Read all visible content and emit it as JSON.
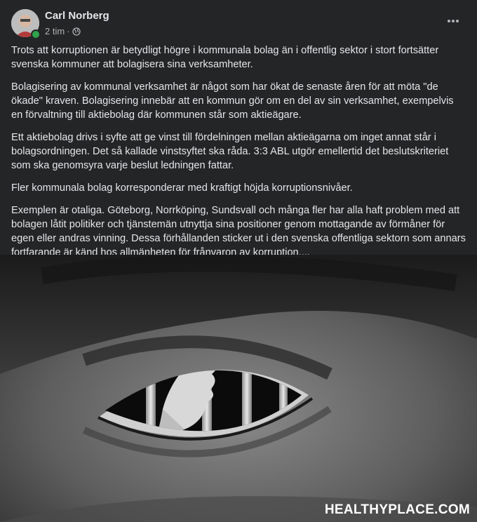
{
  "post": {
    "author": "Carl Norberg",
    "time": "2 tim",
    "separator": "·",
    "privacy_icon": "globe-icon",
    "more_icon": "more-options-icon",
    "paragraphs": [
      "Trots att korruptionen är betydligt högre i kommunala bolag än i offentlig sektor i stort fortsätter svenska kommuner att bolagisera sina verksamheter.",
      "Bolagisering av kommunal verksamhet är något som har ökat de senaste åren för att möta \"de ökade\" kraven. Bolagisering innebär att en kommun gör om en del av sin verksamhet, exempelvis en förvaltning till aktiebolag där kommunen står som aktieägare.",
      "Ett aktiebolag drivs i syfte att ge vinst till fördelningen mellan aktieägarna om inget annat står i bolagsordningen. Det så kallade vinstsyftet ska råda. 3:3 ABL utgör emellertid det beslutskriteriet som ska genomsyra varje beslut ledningen fattar.",
      "Fler kommunala bolag korresponderar med kraftigt höjda korruptionsnivåer.",
      "Exemplen är otaliga. Göteborg, Norrköping, Sundsvall och många fler har alla haft problem med att bolagen låtit politiker och tjänstemän utnyttja sina positioner genom mottagande av förmåner för egen eller andras vinning. Dessa förhållanden sticker ut i den svenska offentliga sektorn som annars fortfarande är känd hos allmänheten för frånvaron av korruption...."
    ],
    "image": {
      "watermark": "HEALTHYPLACE.COM"
    }
  },
  "colors": {
    "background": "#242526",
    "text_primary": "#e4e6eb",
    "text_secondary": "#b0b3b8",
    "online": "#31a24c"
  }
}
